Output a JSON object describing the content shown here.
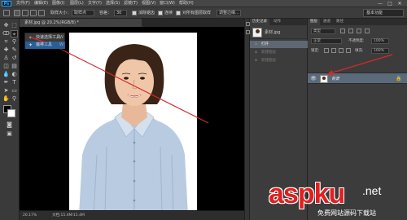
{
  "app": {
    "logo": "Ps"
  },
  "menu": [
    "文件(F)",
    "编辑(E)",
    "图像(I)",
    "图层(L)",
    "文字(Y)",
    "选择(S)",
    "滤镜(T)",
    "视图(V)",
    "窗口(W)",
    "帮助(H)"
  ],
  "window_buttons": {
    "minimize": "—",
    "maximize": "□",
    "close": "✕"
  },
  "options": {
    "size_label": "取样大小：",
    "size_value": "取样点",
    "tolerance_label": "容差：",
    "tolerance_value": "30",
    "antialias_label": "消除锯齿",
    "contiguous_label": "连续",
    "all_layers_label": "对所有图层取样",
    "refine_edge_label": "调整边缘...",
    "workspace": "基本功能"
  },
  "document_tab": "素材.jpg @ 20.2%(RGB/8) *",
  "flyout": {
    "items": [
      {
        "icon": "quick-selection-icon",
        "glyph": "⌖",
        "label": "快速选择工具",
        "key": "W"
      },
      {
        "icon": "magic-wand-icon",
        "glyph": "✦",
        "label": "魔棒工具",
        "key": "W"
      }
    ]
  },
  "status": {
    "zoom": "20.17%",
    "doc_size": "文档:15.4M/15.4M"
  },
  "history": {
    "tabs": [
      "历史记录",
      "动作"
    ],
    "snapshot": "素材.jpg",
    "steps": [
      "打开",
      "新建图层",
      "新建图层"
    ]
  },
  "layers": {
    "tabs": [
      "图层",
      "通道",
      "路径"
    ],
    "kind_filter": "类型",
    "blend_mode": "正常",
    "opacity_label": "不透明度:",
    "opacity_value": "100%",
    "lock_label": "锁定:",
    "fill_label": "填充:",
    "fill_value": "100%",
    "layer_name": "背景"
  },
  "watermark": {
    "main": "aspku",
    "suffix": ".net",
    "sub": "免费网站源码下载站"
  },
  "colors": {
    "arrow": "#d42a2a",
    "menubar": "#464646",
    "panel": "#3c3c3c",
    "selected_layer": "#5a6a7a"
  }
}
